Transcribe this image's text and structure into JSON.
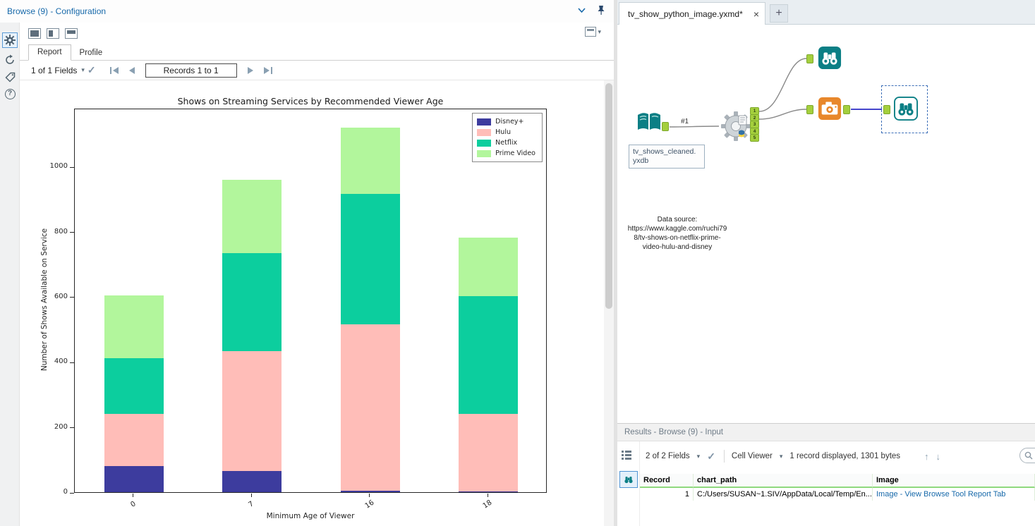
{
  "left_panel": {
    "title": "Browse (9) - Configuration",
    "tabs": {
      "report": "Report",
      "profile": "Profile"
    },
    "fields_dropdown": "1 of 1 Fields",
    "records_label": "Records 1 to 1"
  },
  "chart_data": {
    "type": "bar",
    "stacked": true,
    "title": "Shows on Streaming Services by Recommended Viewer Age",
    "xlabel": "Minimum Age of Viewer",
    "ylabel": "Number of Shows Available on Service",
    "categories": [
      "0",
      "7",
      "16",
      "18"
    ],
    "series": [
      {
        "name": "Disney+",
        "color": "#3d3c9e",
        "values": [
          80,
          65,
          5,
          2
        ]
      },
      {
        "name": "Hulu",
        "color": "#ffbdb8",
        "values": [
          160,
          368,
          510,
          238
        ]
      },
      {
        "name": "Netflix",
        "color": "#0cce9e",
        "values": [
          172,
          300,
          400,
          362
        ]
      },
      {
        "name": "Prime Video",
        "color": "#b2f69c",
        "values": [
          193,
          226,
          205,
          180
        ]
      }
    ],
    "yticks": [
      0,
      200,
      400,
      600,
      800,
      1000
    ],
    "ylim": [
      0,
      1180
    ],
    "legend_position": "upper right",
    "grid": false
  },
  "canvas": {
    "tab_title": "tv_show_python_image.yxmd*",
    "input_label_lines": [
      "tv_shows_cleaned.",
      "yxdb"
    ],
    "connection_label": "#1",
    "python_outputs": [
      "1",
      "2",
      "3",
      "4",
      "5"
    ],
    "annotation_lines": [
      "Data source:",
      "https://www.kaggle.com/ruchi79",
      "8/tv-shows-on-netflix-prime-",
      "video-hulu-and-disney"
    ]
  },
  "results": {
    "title": "Results - Browse (9) - Input",
    "fields_dropdown": "2 of 2 Fields",
    "cell_viewer_label": "Cell Viewer",
    "record_info": "1 record displayed, 1301 bytes",
    "search_placeholder": "Search",
    "columns": [
      "Record",
      "chart_path",
      "Image"
    ],
    "rows": [
      {
        "record": "1",
        "chart_path": "C:/Users/SUSAN~1.SIV/AppData/Local/Temp/En...",
        "image": "Image - View Browse Tool Report Tab"
      }
    ]
  },
  "colors": {
    "accent_blue": "#1769aa",
    "tool_teal": "#0b7f85",
    "tool_orange": "#e8872b",
    "anchor_green": "#a4cf3d",
    "selected_connection": "#4646cc",
    "header_green": "#8fd97e"
  }
}
